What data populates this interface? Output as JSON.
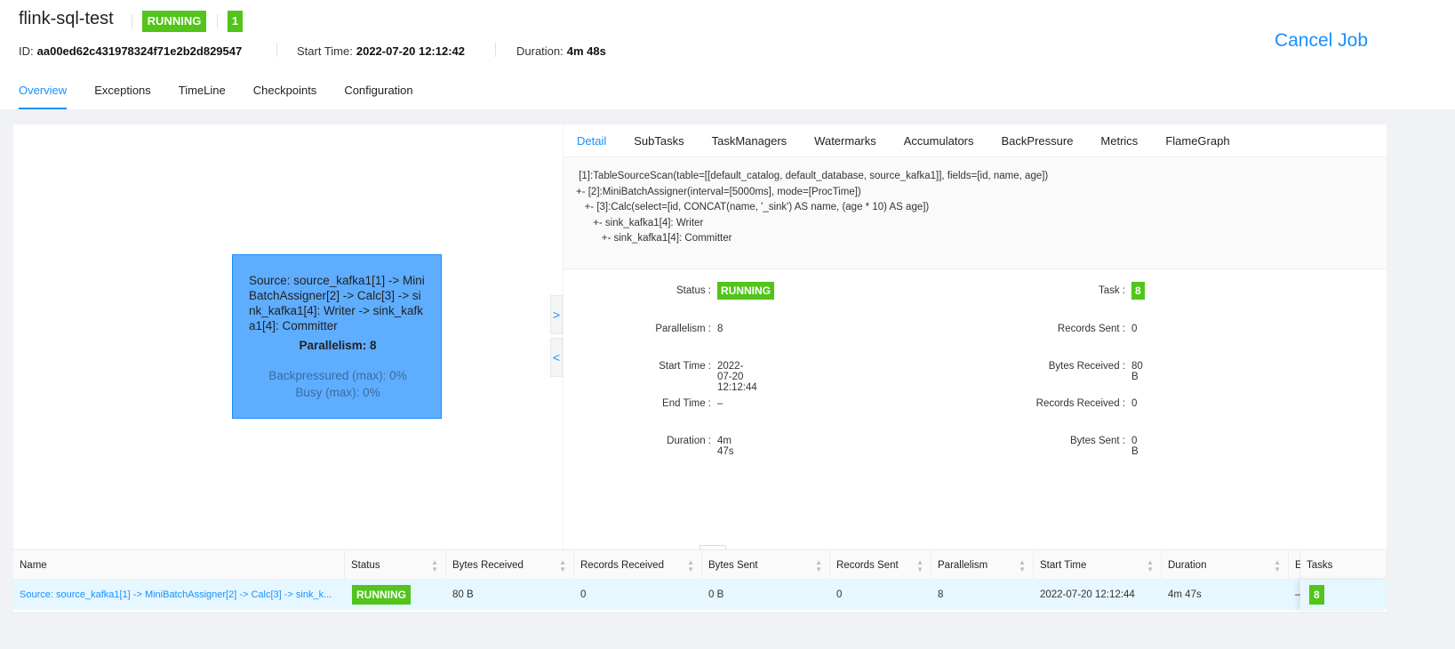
{
  "job": {
    "name": "flink-sql-test",
    "status": "RUNNING",
    "count": "1",
    "id_label": "ID:",
    "id": "aa00ed62c431978324f71e2b2d829547",
    "start_label": "Start Time:",
    "start": "2022-07-20 12:12:42",
    "duration_label": "Duration:",
    "duration": "4m 48s",
    "cancel": "Cancel Job"
  },
  "tabs": [
    "Overview",
    "Exceptions",
    "TimeLine",
    "Checkpoints",
    "Configuration"
  ],
  "node": {
    "title": "Source: source_kafka1[1] -> MiniBatchAssigner[2] -> Calc[3] -> sink_kafka1[4]: Writer -> sink_kafka1[4]: Committer",
    "parallelism": "Parallelism: 8",
    "backpressured": "Backpressured (max): 0%",
    "busy": "Busy (max): 0%"
  },
  "detail_tabs": [
    "Detail",
    "SubTasks",
    "TaskManagers",
    "Watermarks",
    "Accumulators",
    "BackPressure",
    "Metrics",
    "FlameGraph"
  ],
  "plan": [
    " [1]:TableSourceScan(table=[[default_catalog, default_database, source_kafka1]], fields=[id, name, age])",
    "+- [2]:MiniBatchAssigner(interval=[5000ms], mode=[ProcTime])",
    "   +- [3]:Calc(select=[id, CONCAT(name, '_sink') AS name, (age * 10) AS age])",
    "      +- sink_kafka1[4]: Writer",
    "         +- sink_kafka1[4]: Committer"
  ],
  "detail": {
    "left": [
      {
        "label": "Status",
        "value": "RUNNING"
      },
      {
        "label": "Parallelism",
        "value": "8"
      },
      {
        "label": "Start Time",
        "value": "2022-07-20 12:12:44"
      },
      {
        "label": "End Time",
        "value": "–"
      },
      {
        "label": "Duration",
        "value": "4m 47s"
      }
    ],
    "right": [
      {
        "label": "Task",
        "value": "8"
      },
      {
        "label": "Records Sent",
        "value": "0"
      },
      {
        "label": "Bytes Received",
        "value": "80 B"
      },
      {
        "label": "Records Received",
        "value": "0"
      },
      {
        "label": "Bytes Sent",
        "value": "0 B"
      }
    ]
  },
  "table": {
    "headers": [
      "Name",
      "Status",
      "Bytes Received",
      "Records Received",
      "Bytes Sent",
      "Records Sent",
      "Parallelism",
      "Start Time",
      "Duration",
      "E",
      "Tasks"
    ],
    "row": [
      "Source: source_kafka1[1] -> MiniBatchAssigner[2] -> Calc[3] -> sink_k...",
      "RUNNING",
      "80 B",
      "0",
      "0 B",
      "0",
      "8",
      "2022-07-20 12:12:44",
      "4m 47s",
      "–",
      "8"
    ]
  }
}
